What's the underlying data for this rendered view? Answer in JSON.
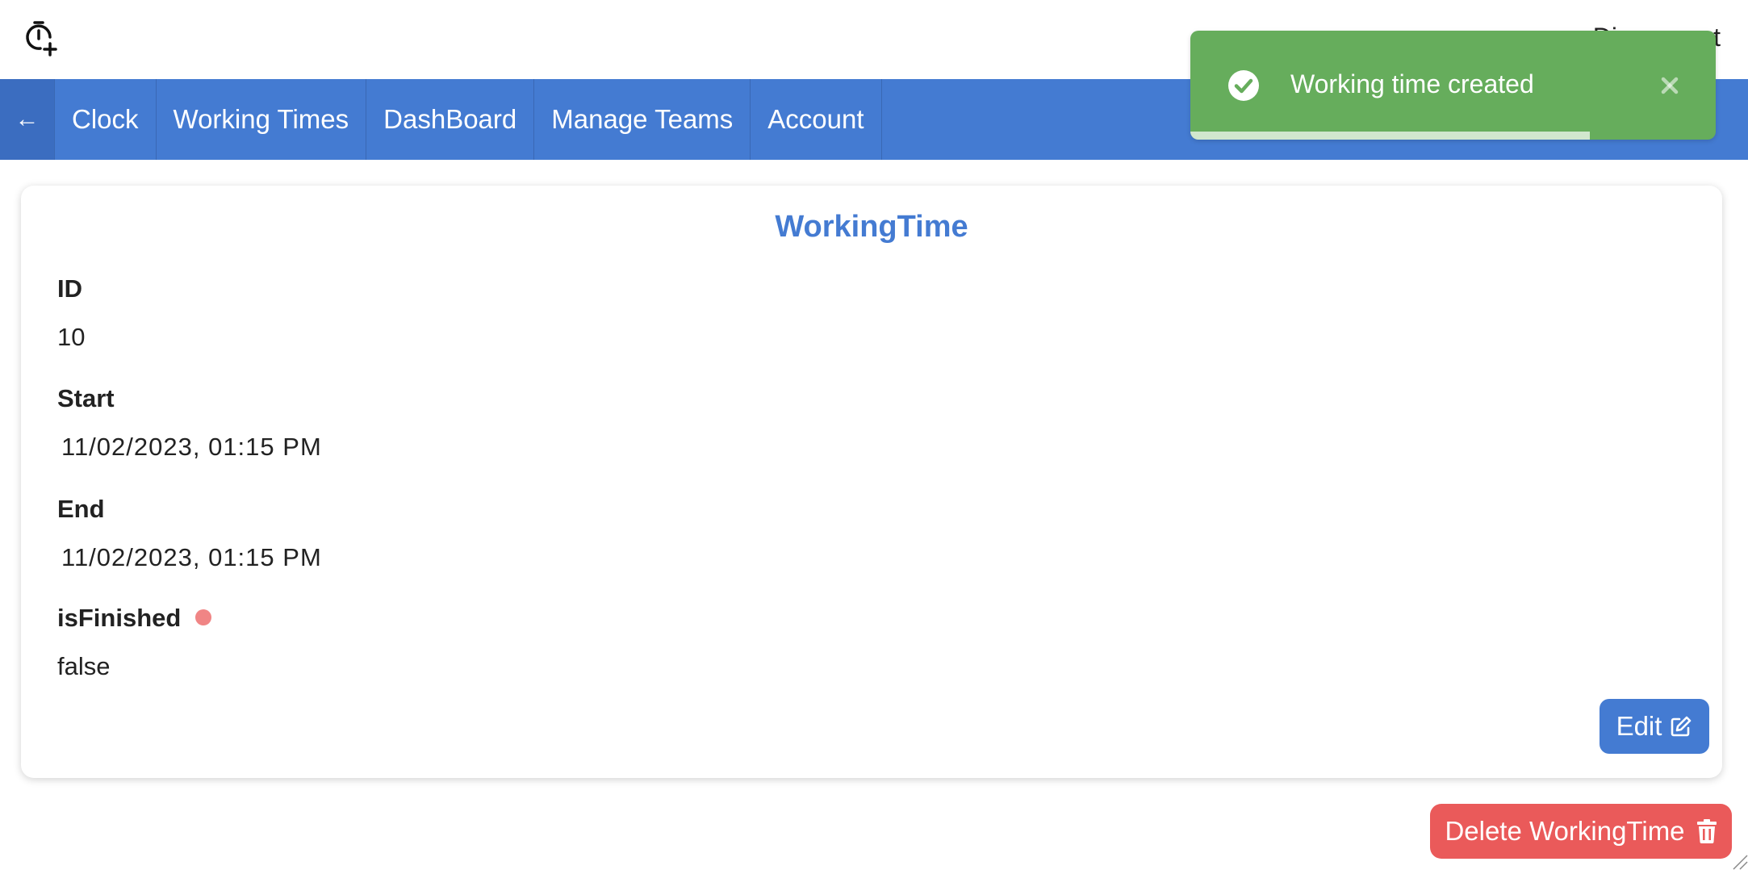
{
  "header": {
    "logo_icon": "stopwatch-plus-icon",
    "right_text": "Disconnect"
  },
  "nav": {
    "back_icon": "arrow-left-icon",
    "back_label": "←",
    "items": [
      {
        "label": "Clock"
      },
      {
        "label": "Working Times"
      },
      {
        "label": "DashBoard"
      },
      {
        "label": "Manage Teams"
      },
      {
        "label": "Account"
      }
    ]
  },
  "card": {
    "title": "WorkingTime",
    "fields": {
      "id": {
        "label": "ID",
        "value": "10"
      },
      "start": {
        "label": "Start",
        "value": "11/02/2023, 01:15 PM"
      },
      "end": {
        "label": "End",
        "value": "11/02/2023, 01:15 PM"
      },
      "is_finished": {
        "label": "isFinished",
        "value": "false",
        "status_color": "#f08585"
      }
    },
    "edit_label": "Edit",
    "edit_icon": "edit-icon"
  },
  "delete_label": "Delete WorkingTime",
  "delete_icon": "trash-icon",
  "toast": {
    "message": "Working time created",
    "icon": "check-circle-icon",
    "close_icon": "close-icon",
    "progress": 0.76,
    "color": "#66ad5c"
  },
  "colors": {
    "primary": "#447bd2",
    "danger": "#ea5a5a",
    "success": "#66ad5c"
  }
}
